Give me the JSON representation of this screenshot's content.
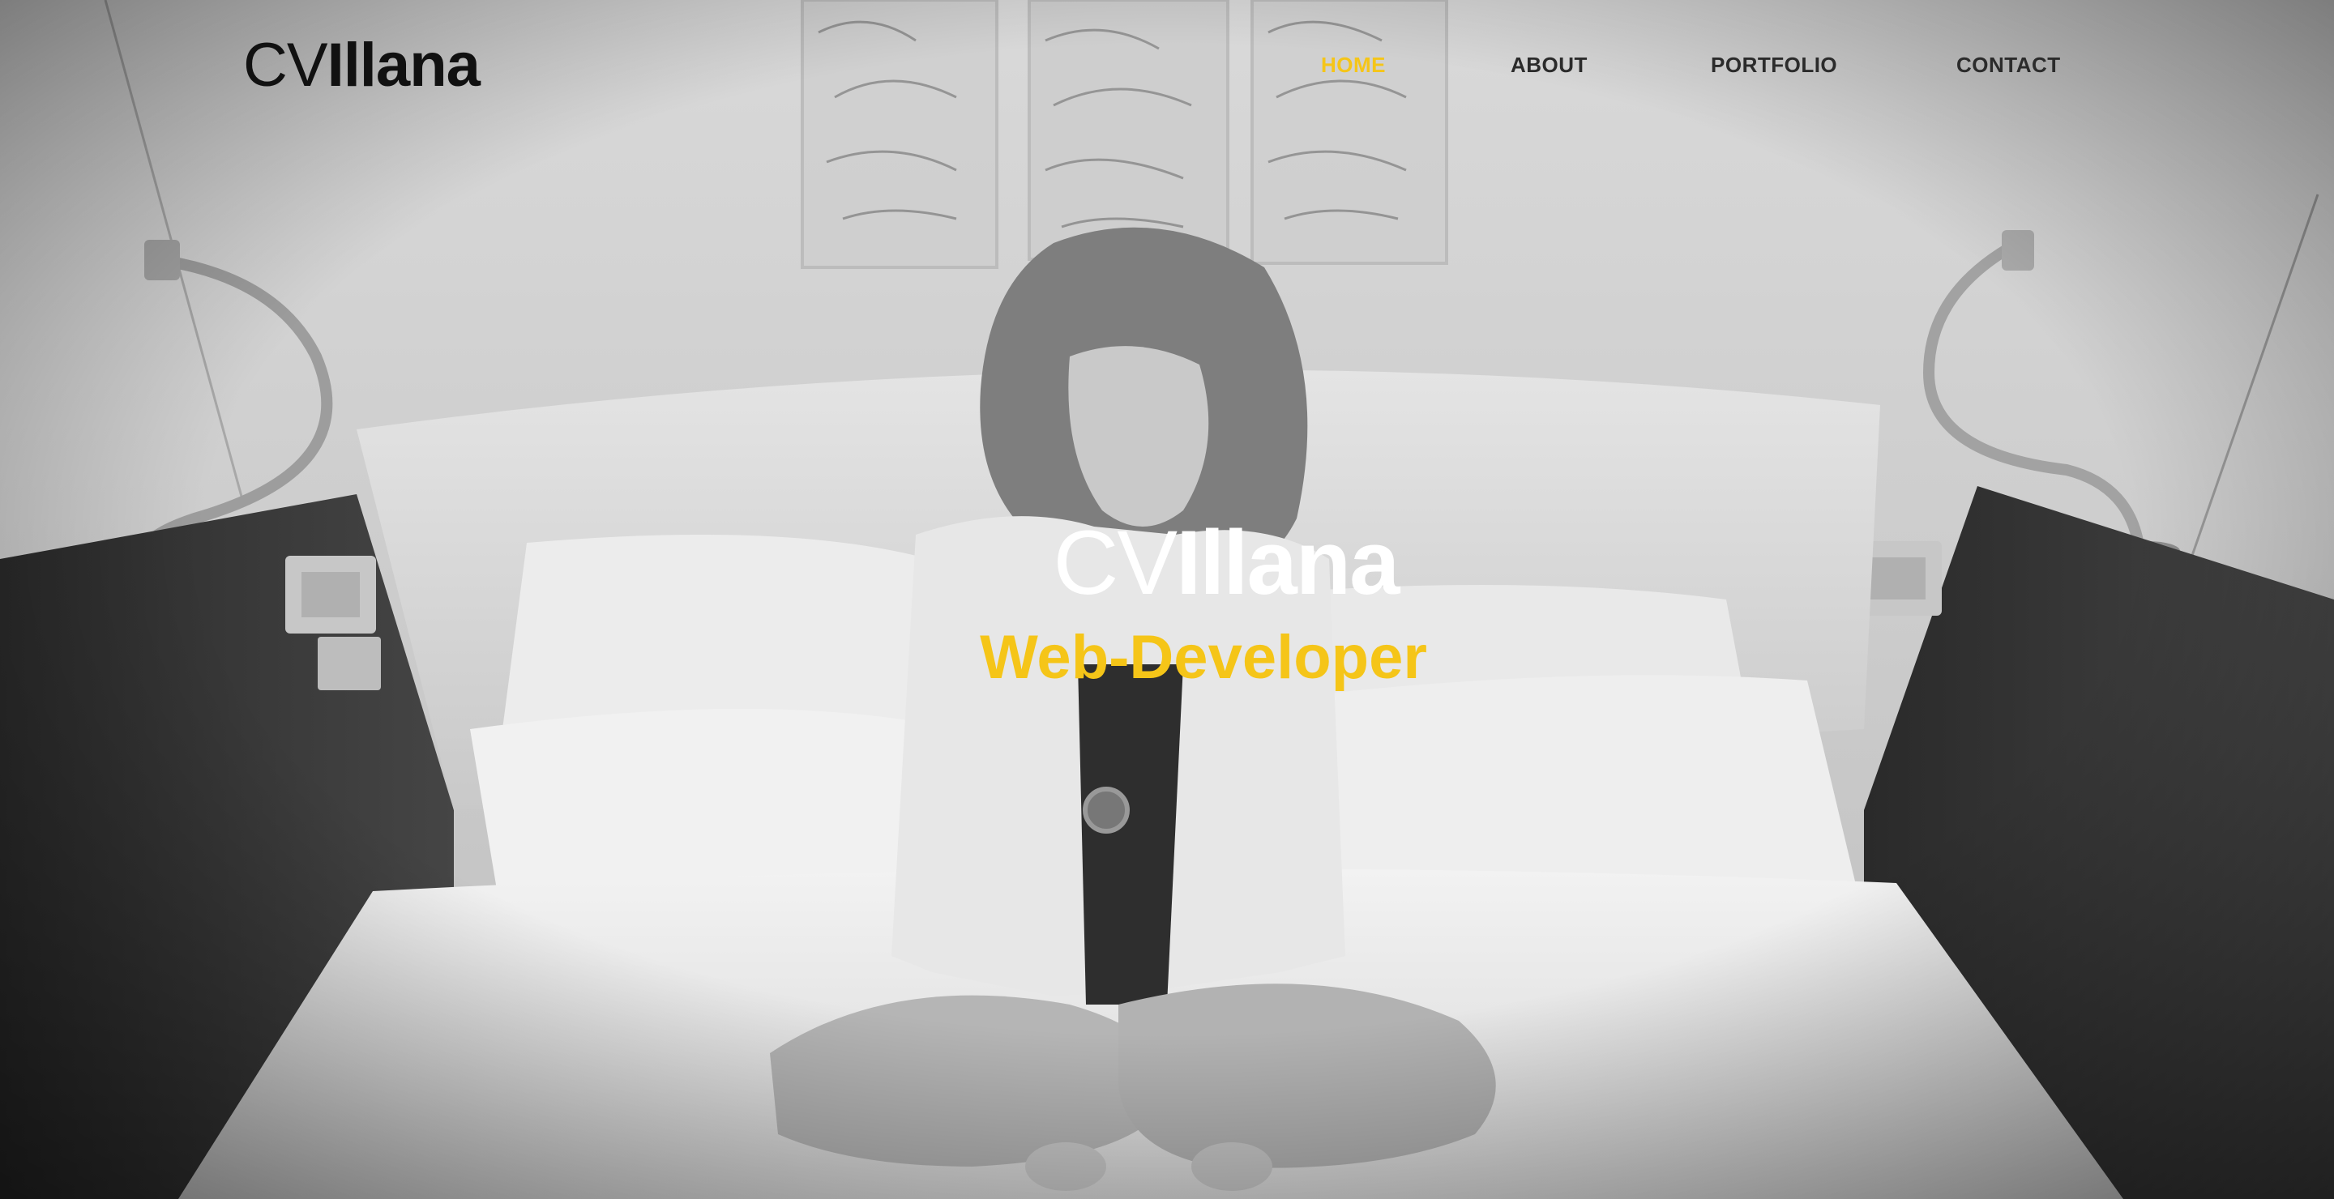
{
  "brand": {
    "logo_prefix": "CV",
    "logo_name": "Illana"
  },
  "nav": {
    "items": [
      {
        "label": "HOME",
        "active": true
      },
      {
        "label": "ABOUT",
        "active": false
      },
      {
        "label": "PORTFOLIO",
        "active": false
      },
      {
        "label": "CONTACT",
        "active": false
      }
    ]
  },
  "hero": {
    "title_prefix": "CV",
    "title_name": "Illana",
    "subtitle": "Web-Developer",
    "background": "grayscale-photo-woman-sitting-on-bed"
  },
  "colors": {
    "accent": "#f5c518",
    "nav_text": "#2b2b2b",
    "logo_text": "#111111",
    "hero_text": "#ffffff"
  }
}
